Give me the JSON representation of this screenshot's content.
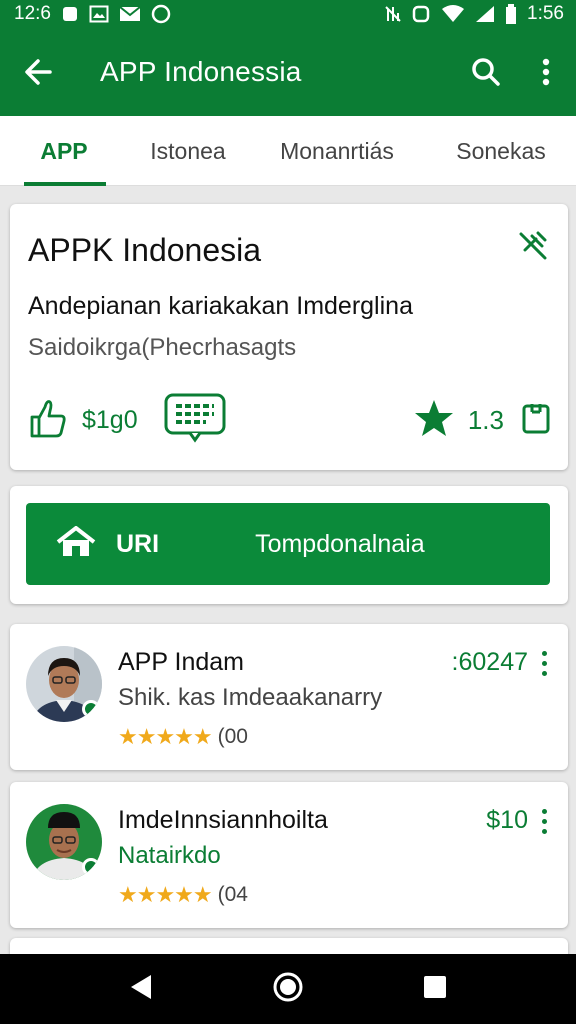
{
  "status_bar": {
    "time": "12:6",
    "clock": "1:56",
    "icons_left": [
      "square-icon",
      "image-icon",
      "mail-icon",
      "chat-icon"
    ],
    "icons_right": [
      "no-signal-icon",
      "alarm-icon",
      "wifi-icon",
      "cell-icon",
      "battery-icon"
    ]
  },
  "app_bar": {
    "title": "APP Indonessia",
    "back_icon": "arrow-left-icon",
    "search_icon": "search-icon",
    "more_icon": "more-vert-icon"
  },
  "tabs": [
    {
      "label": "APP",
      "active": true
    },
    {
      "label": "Istonea",
      "active": false
    },
    {
      "label": "Monanrtiás",
      "active": false
    },
    {
      "label": "Sonekas",
      "active": false
    }
  ],
  "summary_card": {
    "title": "APPK Indonesia",
    "line1": "Andepianan kariakakan Imderglina",
    "line2": "Saidoikrga(Phecrhasagts",
    "price": "$1g0",
    "rating": "1.3",
    "icons": [
      "thumbs-up-icon",
      "chat-bubble-icon",
      "star-icon",
      "bookmark-icon",
      "pin-off-icon"
    ]
  },
  "action_button": {
    "left_label": "URI",
    "right_label": "Tompdonalnaia",
    "icon": "home-icon"
  },
  "list": [
    {
      "name": "APP Indam",
      "subtitle": "Shik. kas Imdeaakanarry",
      "subtitle_green": false,
      "amount": ":60247",
      "stars": "★★★★★",
      "rating_count": "(00"
    },
    {
      "name": "ImdeInnsiannhoilta",
      "subtitle": "Natairkdo",
      "subtitle_green": true,
      "amount": "$10",
      "stars": "★★★★★",
      "rating_count": "(04"
    }
  ],
  "colors": {
    "primary": "#0b7d34",
    "button": "#0b8a3a",
    "star": "#f0a91b",
    "background": "#e8e8e8"
  },
  "nav_bar": {
    "icons": [
      "back-triangle-icon",
      "home-circle-icon",
      "recents-square-icon"
    ]
  }
}
